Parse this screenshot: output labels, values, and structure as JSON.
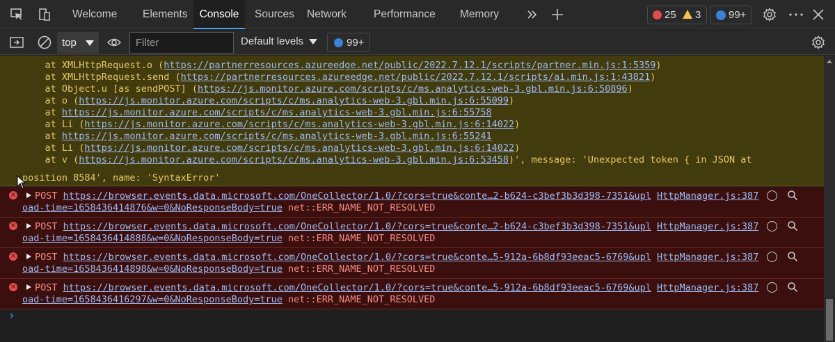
{
  "tabs": {
    "welcome": "Welcome",
    "elements": "Elements",
    "console": "Console",
    "sources": "Sources",
    "network": "Network",
    "performance": "Performance",
    "memory": "Memory"
  },
  "badges": {
    "errors": "25",
    "warnings": "3",
    "messages": "99+"
  },
  "toolbar": {
    "context": "top",
    "filter_placeholder": "Filter",
    "levels": "Default levels",
    "issues": "99+"
  },
  "warning_lines": [
    {
      "prefix": "    at ",
      "pre": "XMLHttpRequest.o (",
      "url": "https://partnerresources.azureedge.net/public/2022.7.12.1/scripts/partner.min.js:1:5359",
      "post": ")"
    },
    {
      "prefix": "    at ",
      "pre": "XMLHttpRequest.send (",
      "url": "https://partnerresources.azureedge.net/public/2022.7.12.1/scripts/ai.min.js:1:43821",
      "post": ")"
    },
    {
      "prefix": "    at ",
      "pre": "Object.u [as sendPOST] (",
      "url": "https://js.monitor.azure.com/scripts/c/ms.analytics-web-3.gbl.min.js:6:50896",
      "post": ")"
    },
    {
      "prefix": "    at ",
      "pre": "o (",
      "url": "https://js.monitor.azure.com/scripts/c/ms.analytics-web-3.gbl.min.js:6:55099",
      "post": ")"
    },
    {
      "prefix": "    at ",
      "pre": "",
      "url": "https://js.monitor.azure.com/scripts/c/ms.analytics-web-3.gbl.min.js:6:55758",
      "post": ""
    },
    {
      "prefix": "    at ",
      "pre": "Li (",
      "url": "https://js.monitor.azure.com/scripts/c/ms.analytics-web-3.gbl.min.js:6:14022",
      "post": ")"
    },
    {
      "prefix": "    at ",
      "pre": "",
      "url": "https://js.monitor.azure.com/scripts/c/ms.analytics-web-3.gbl.min.js:6:55241",
      "post": ""
    },
    {
      "prefix": "    at ",
      "pre": "Li (",
      "url": "https://js.monitor.azure.com/scripts/c/ms.analytics-web-3.gbl.min.js:6:14022",
      "post": ")"
    },
    {
      "prefix": "    at ",
      "pre": "v (",
      "url": "https://js.monitor.azure.com/scripts/c/ms.analytics-web-3.gbl.min.js:6:53458",
      "post": ")', message: 'Unexpected token { in JSON at"
    }
  ],
  "warning_last": "position 8584', name: 'SyntaxError'",
  "errors": [
    {
      "method": "POST",
      "url1": "https://browser.events.data.microsoft.com/OneCollector/1.0/?cors=true&conte…2-b624-c3bef3b3d398-7351&upl",
      "url2": "oad-time=1658436414876&w=0&NoResponseBody=true",
      "msg": "net::ERR_NAME_NOT_RESOLVED",
      "source": "HttpManager.js:387"
    },
    {
      "method": "POST",
      "url1": "https://browser.events.data.microsoft.com/OneCollector/1.0/?cors=true&conte…2-b624-c3bef3b3d398-7351&upl",
      "url2": "oad-time=1658436414888&w=0&NoResponseBody=true",
      "msg": "net::ERR_NAME_NOT_RESOLVED",
      "source": "HttpManager.js:387"
    },
    {
      "method": "POST",
      "url1": "https://browser.events.data.microsoft.com/OneCollector/1.0/?cors=true&conte…5-912a-6b8df93eeac5-6769&upl",
      "url2": "oad-time=1658436414898&w=0&NoResponseBody=true",
      "msg": "net::ERR_NAME_NOT_RESOLVED",
      "source": "HttpManager.js:387"
    },
    {
      "method": "POST",
      "url1": "https://browser.events.data.microsoft.com/OneCollector/1.0/?cors=true&conte…5-912a-6b8df93eeac5-6769&upl",
      "url2": "oad-time=1658436416297&w=0&NoResponseBody=true",
      "msg": "net::ERR_NAME_NOT_RESOLVED",
      "source": "HttpManager.js:387"
    }
  ],
  "colors": {
    "warning_bg": "#413b0d",
    "warning_text": "#e6c76b",
    "error_bg": "#3c0f0f",
    "error_text": "#f28b82",
    "link": "#9ebbf2",
    "accent": "#4aa3f5"
  },
  "icons": [
    "inspect-icon",
    "device-emulation-icon",
    "more-tabs-icon",
    "add-tab-icon",
    "error-icon",
    "warning-icon",
    "message-icon",
    "settings-icon",
    "more-options-icon",
    "close-icon",
    "toggle-sidebar-icon",
    "clear-console-icon",
    "chevron-down-icon",
    "eye-icon",
    "expand-triangle-icon",
    "search-icon",
    "network-icon",
    "prompt-chevron-icon"
  ]
}
